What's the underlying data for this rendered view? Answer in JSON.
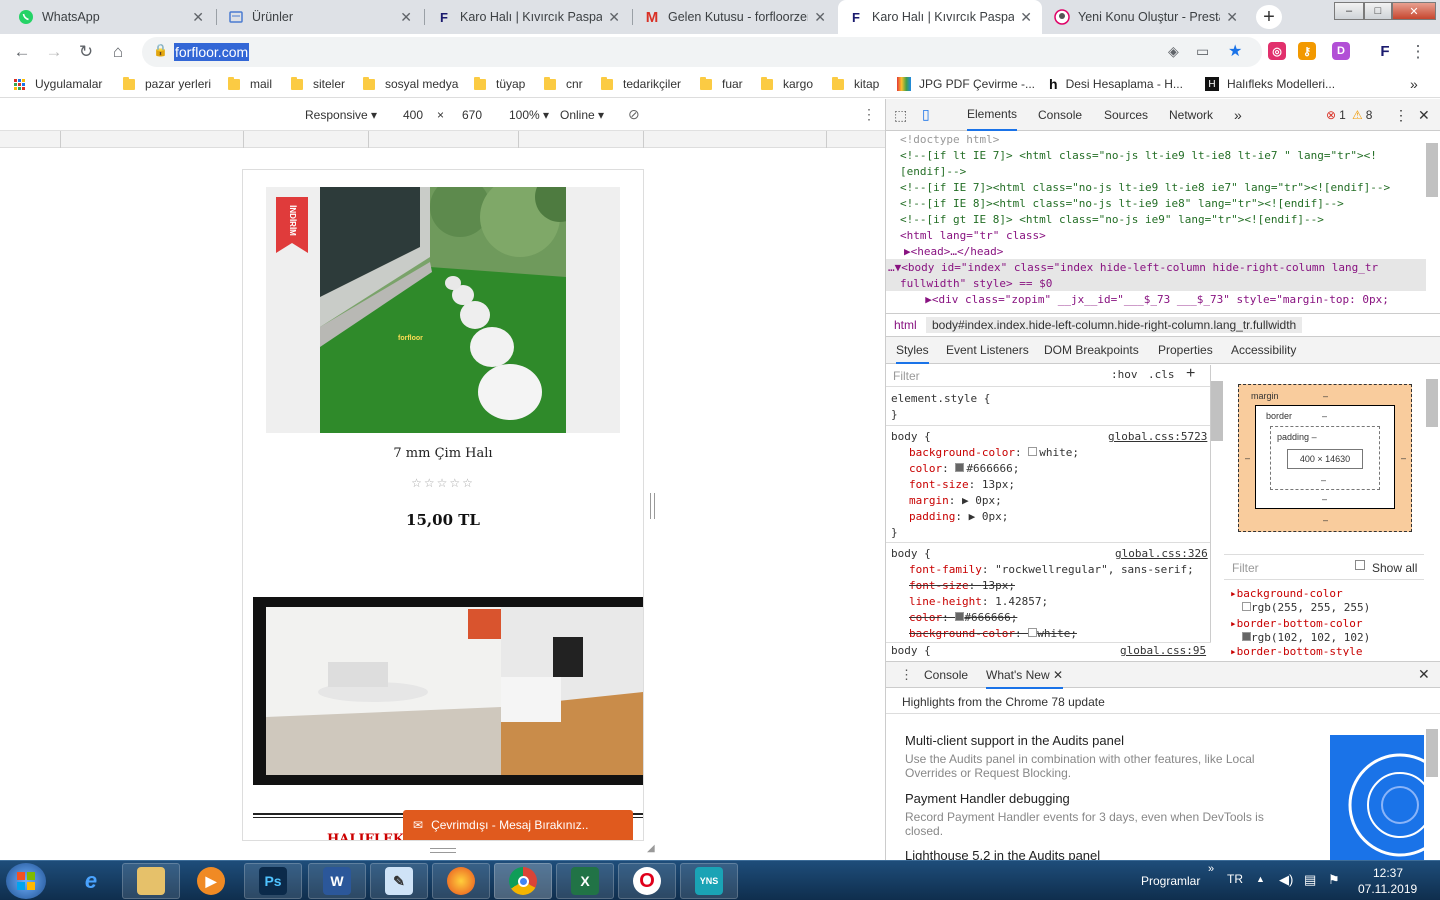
{
  "tabs": [
    {
      "title": "WhatsApp",
      "icon": "whatsapp-icon",
      "color": "#25d366"
    },
    {
      "title": "Ürünler",
      "icon": "page-icon",
      "color": "#4a7bd0"
    },
    {
      "title": "Karo Halı | Kıvırcık Paspas |",
      "icon": "forfloor-icon",
      "color": "#1a1a6e"
    },
    {
      "title": "Gelen Kutusu - forfloorzem",
      "icon": "gmail-icon",
      "color": "#d93025"
    },
    {
      "title": "Karo Halı | Kıvırcık Paspas |",
      "icon": "forfloor-icon",
      "color": "#1a1a6e"
    },
    {
      "title": "Yeni Konu Oluştur - Presta",
      "icon": "prestashop-icon",
      "color": "#df0067"
    }
  ],
  "window_controls": [
    "–",
    "□",
    "✕"
  ],
  "address": {
    "url": "forfloor.com"
  },
  "bookmarks": [
    {
      "label": "Uygulamalar",
      "type": "apps"
    },
    {
      "label": "pazar yerleri",
      "type": "folder"
    },
    {
      "label": "mail",
      "type": "folder"
    },
    {
      "label": "siteler",
      "type": "folder"
    },
    {
      "label": "sosyal medya",
      "type": "folder"
    },
    {
      "label": "tüyap",
      "type": "folder"
    },
    {
      "label": "cnr",
      "type": "folder"
    },
    {
      "label": "tedarikçiler",
      "type": "folder"
    },
    {
      "label": "fuar",
      "type": "folder"
    },
    {
      "label": "kargo",
      "type": "folder"
    },
    {
      "label": "kitap",
      "type": "folder"
    },
    {
      "label": "JPG PDF Çevirme -...",
      "type": "site"
    },
    {
      "label": "Desi Hesaplama - H...",
      "type": "site"
    },
    {
      "label": "Halıfleks Modelleri...",
      "type": "site"
    }
  ],
  "bookmarks_more": "»",
  "emulation": {
    "mode": "Responsive",
    "width": "400",
    "x": "×",
    "height": "670",
    "zoom": "100%",
    "network": "Online"
  },
  "page": {
    "badge": "İNDİRİM",
    "product_name": "7 mm Çim Halı",
    "stars": "☆☆☆☆☆",
    "price": "15,00 TL",
    "heading_partial": "HALIFLEKS",
    "chat_label": "Çevrimdışı - Mesaj Bırakınız..",
    "grass_logo": "forfloor"
  },
  "devtools": {
    "tabs": [
      "Elements",
      "Console",
      "Sources",
      "Network"
    ],
    "more": "»",
    "errors": "1",
    "warnings": "8",
    "dom_lines": [
      "<!doctype html>",
      "<!--[if lt IE 7]> <html class=\"no-js lt-ie9 lt-ie8 lt-ie7 \" lang=\"tr\"><!",
      "[endif]-->",
      "<!--[if IE 7]><html class=\"no-js lt-ie9 lt-ie8 ie7\" lang=\"tr\"><![endif]-->",
      "<!--[if IE 8]><html class=\"no-js lt-ie9 ie8\" lang=\"tr\"><![endif]-->",
      "<!--[if gt IE 8]> <html class=\"no-js ie9\" lang=\"tr\"><![endif]-->",
      "<html lang=\"tr\" class>",
      "▶<head>…</head>",
      "…▼<body id=\"index\" class=\"index hide-left-column hide-right-column lang_tr",
      "fullwidth\" style> == $0",
      "  ▶<div class=\"zopim\" __jx__id=\"___$_73 ___$_73\" style=\"margin-top: 0px;"
    ],
    "breadcrumb": [
      "html",
      "body#index.index.hide-left-column.hide-right-column.lang_tr.fullwidth"
    ],
    "subtabs": [
      "Styles",
      "Event Listeners",
      "DOM Breakpoints",
      "Properties",
      "Accessibility"
    ],
    "filter_placeholder": "Filter",
    "hov": ":hov",
    "cls": ".cls",
    "styles": {
      "element_style": "element.style {",
      "close": "}",
      "rule1": {
        "selector": "body {",
        "source": "global.css:5723",
        "props": [
          {
            "name": "background-color",
            "value": "white;"
          },
          {
            "name": "color",
            "value": "#666666;"
          },
          {
            "name": "font-size",
            "value": "13px;"
          },
          {
            "name": "margin",
            "value": "▶ 0px;"
          },
          {
            "name": "padding",
            "value": "▶ 0px;"
          }
        ]
      },
      "rule2": {
        "selector": "body {",
        "source": "global.css:326",
        "props": [
          {
            "name": "font-family",
            "value": "\"rockwellregular\", sans-serif;",
            "struck": false
          },
          {
            "name": "font-size",
            "value": "13px;",
            "struck": true
          },
          {
            "name": "line-height",
            "value": "1.42857;",
            "struck": false
          },
          {
            "name": "color",
            "value": "#666666;",
            "struck": true
          },
          {
            "name": "background-color",
            "value": "white;",
            "struck": true
          }
        ]
      },
      "rule3": {
        "selector": "body {",
        "source": "global.css:95"
      }
    },
    "boxmodel": {
      "margin": "margin",
      "border": "border",
      "padding": "padding",
      "dash": "–",
      "content": "400 × 14630"
    },
    "computed": {
      "filter_placeholder": "Filter",
      "show_all": "Show all",
      "items": [
        {
          "name": "background-color",
          "value": "rgb(255, 255, 255)"
        },
        {
          "name": "border-bottom-color",
          "value": "rgb(102, 102, 102)"
        },
        {
          "name": "border-bottom-style",
          "value": ""
        }
      ]
    },
    "drawer": {
      "tabs": [
        "Console",
        "What's New"
      ],
      "title": "Highlights from the Chrome 78 update",
      "items": [
        {
          "title": "Multi-client support in the Audits panel",
          "desc": "Use the Audits panel in combination with other features, like Local Overrides or Request Blocking."
        },
        {
          "title": "Payment Handler debugging",
          "desc": "Record Payment Handler events for 3 days, even when DevTools is closed."
        },
        {
          "title": "Lighthouse 5.2 in the Audits panel",
          "desc": ""
        }
      ]
    }
  },
  "taskbar": {
    "apps": [
      "start",
      "ie",
      "explorer",
      "media",
      "photoshop",
      "word",
      "notes",
      "firefox",
      "chrome",
      "excel",
      "opera",
      "yns"
    ],
    "programs_label": "Programlar",
    "chevron": "»",
    "lang": "TR",
    "time": "12:37",
    "date": "07.11.2019"
  }
}
